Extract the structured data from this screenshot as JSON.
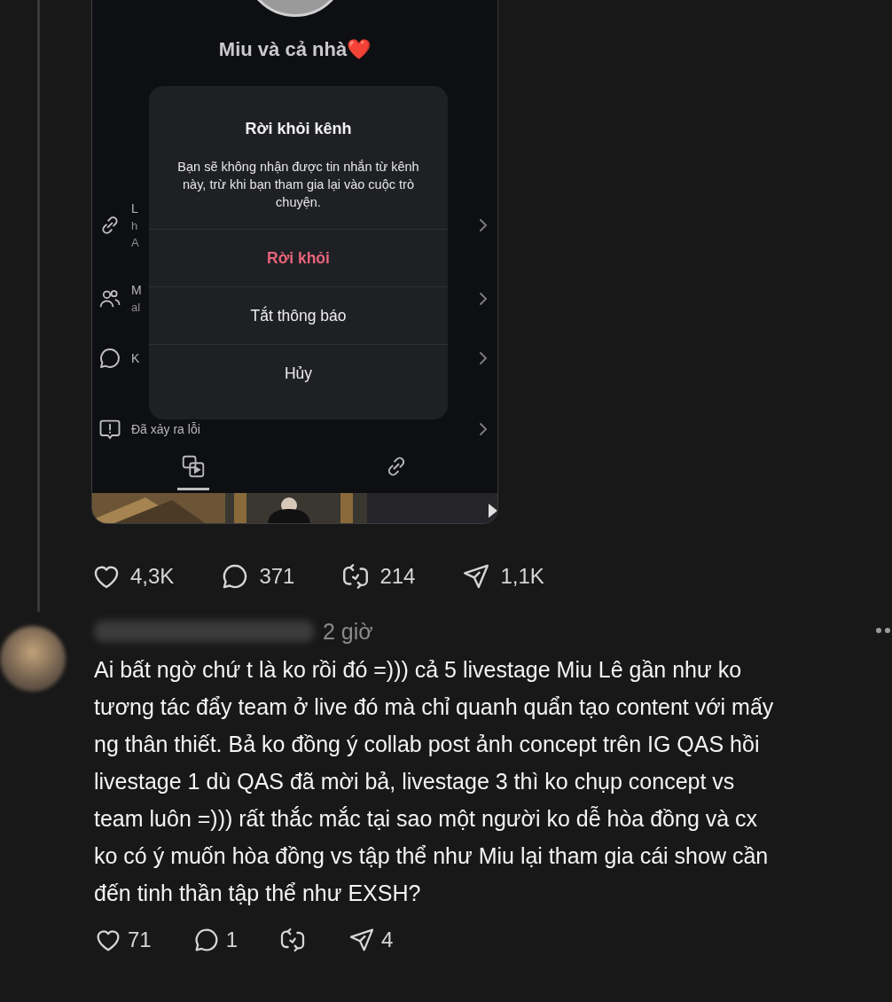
{
  "shared_screenshot": {
    "group_name": "Miu và cả nhà❤️",
    "background_rows": [
      {
        "lines": [
          "L",
          "h",
          "A"
        ]
      },
      {
        "lines": [
          "M",
          "al"
        ]
      },
      {
        "lines": [
          "K"
        ]
      },
      {
        "lines": [
          "Đã xảy ra lỗi"
        ]
      }
    ],
    "tabs": [
      {
        "selected": true
      },
      {
        "selected": false
      }
    ],
    "dialog": {
      "title": "Rời khỏi kênh",
      "message": "Bạn sẽ không nhận được tin nhắn từ kênh này, trừ khi bạn tham gia lại vào cuộc trò chuyện.",
      "buttons": [
        {
          "label": "Rời khỏi",
          "kind": "destructive"
        },
        {
          "label": "Tắt thông báo",
          "kind": "normal"
        },
        {
          "label": "Hủy",
          "kind": "normal"
        }
      ]
    }
  },
  "post_actions": [
    {
      "kind": "like",
      "count": "4,3K"
    },
    {
      "kind": "comment",
      "count": "371"
    },
    {
      "kind": "repost",
      "count": "214"
    },
    {
      "kind": "share",
      "count": "1,1K"
    }
  ],
  "reply": {
    "time": "2 giờ",
    "lines": [
      "Ai bất ngờ chứ t là ko rồi đó =))) cả 5 livestage Miu Lê gần như ko",
      "tương tác đẩy team ở live đó mà chỉ quanh quẩn tạo content với mấy",
      "ng thân thiết. Bả ko đồng ý collab post ảnh concept trên IG QAS hồi",
      "livestage 1 dù QAS đã mời bả, livestage 3 thì ko chụp concept vs",
      "team luôn =))) rất thắc mắc tại sao một người ko dễ hòa đồng và cx",
      "ko có ý muốn hòa đồng vs tập thể như Miu lại tham gia cái show cần",
      "đến tinh thần tập thể như EXSH?"
    ],
    "actions": [
      {
        "kind": "like",
        "count": "71"
      },
      {
        "kind": "comment",
        "count": "1"
      },
      {
        "kind": "repost"
      },
      {
        "kind": "share",
        "count": "4"
      }
    ]
  }
}
